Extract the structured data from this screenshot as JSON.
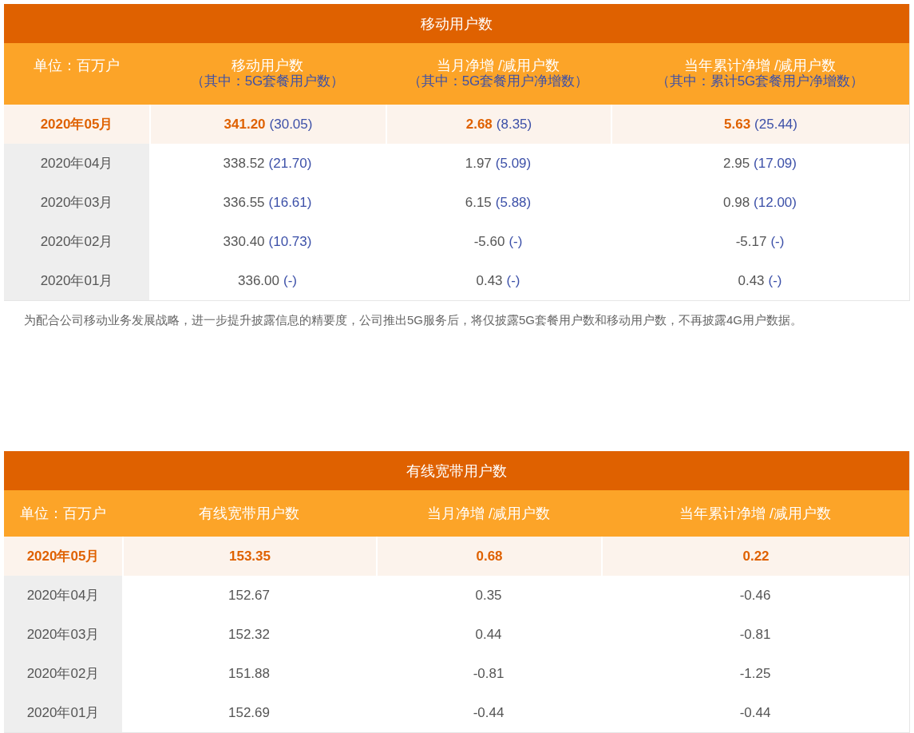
{
  "tables": [
    {
      "title": "移动用户数",
      "columns": [
        {
          "label": "单位：百万户"
        },
        {
          "label": "移动用户数",
          "sub": "（其中：5G套餐用户数）"
        },
        {
          "label": "当月净增 /减用户数",
          "sub": "（其中：5G套餐用户净增数）"
        },
        {
          "label": "当年累计净增 /减用户数",
          "sub": "（其中：累计5G套餐用户净增数）"
        }
      ],
      "rows": [
        {
          "highlighted": true,
          "cells": [
            {
              "value": "2020年05月"
            },
            {
              "value": "341.20",
              "sub": "(30.05)"
            },
            {
              "value": "2.68",
              "sub": "(8.35)"
            },
            {
              "value": "5.63",
              "sub": "(25.44)"
            }
          ]
        },
        {
          "highlighted": false,
          "cells": [
            {
              "value": "2020年04月"
            },
            {
              "value": "338.52",
              "sub": "(21.70)"
            },
            {
              "value": "1.97",
              "sub": "(5.09)"
            },
            {
              "value": "2.95",
              "sub": "(17.09)"
            }
          ]
        },
        {
          "highlighted": false,
          "cells": [
            {
              "value": "2020年03月"
            },
            {
              "value": "336.55",
              "sub": "(16.61)"
            },
            {
              "value": "6.15",
              "sub": "(5.88)"
            },
            {
              "value": "0.98",
              "sub": "(12.00)"
            }
          ]
        },
        {
          "highlighted": false,
          "cells": [
            {
              "value": "2020年02月"
            },
            {
              "value": "330.40",
              "sub": "(10.73)"
            },
            {
              "value": "-5.60",
              "sub": "(-)"
            },
            {
              "value": "-5.17",
              "sub": "(-)"
            }
          ]
        },
        {
          "highlighted": false,
          "cells": [
            {
              "value": "2020年01月"
            },
            {
              "value": "336.00",
              "sub": "(-)"
            },
            {
              "value": "0.43",
              "sub": "(-)"
            },
            {
              "value": "0.43",
              "sub": "(-)"
            }
          ]
        }
      ],
      "note": "为配合公司移动业务发展战略，进一步提升披露信息的精要度，公司推出5G服务后，将仅披露5G套餐用户数和移动用户数，不再披露4G用户数据。"
    },
    {
      "title": "有线宽带用户数",
      "columns": [
        {
          "label": "单位：百万户"
        },
        {
          "label": "有线宽带用户数"
        },
        {
          "label": "当月净增 /减用户数"
        },
        {
          "label": "当年累计净增 /减用户数"
        }
      ],
      "rows": [
        {
          "highlighted": true,
          "cells": [
            {
              "value": "2020年05月"
            },
            {
              "value": "153.35"
            },
            {
              "value": "0.68"
            },
            {
              "value": "0.22"
            }
          ]
        },
        {
          "highlighted": false,
          "cells": [
            {
              "value": "2020年04月"
            },
            {
              "value": "152.67"
            },
            {
              "value": "0.35"
            },
            {
              "value": "-0.46"
            }
          ]
        },
        {
          "highlighted": false,
          "cells": [
            {
              "value": "2020年03月"
            },
            {
              "value": "152.32"
            },
            {
              "value": "0.44"
            },
            {
              "value": "-0.81"
            }
          ]
        },
        {
          "highlighted": false,
          "cells": [
            {
              "value": "2020年02月"
            },
            {
              "value": "151.88"
            },
            {
              "value": "-0.81"
            },
            {
              "value": "-1.25"
            }
          ]
        },
        {
          "highlighted": false,
          "cells": [
            {
              "value": "2020年01月"
            },
            {
              "value": "152.69"
            },
            {
              "value": "-0.44"
            },
            {
              "value": "-0.44"
            }
          ]
        }
      ]
    }
  ]
}
